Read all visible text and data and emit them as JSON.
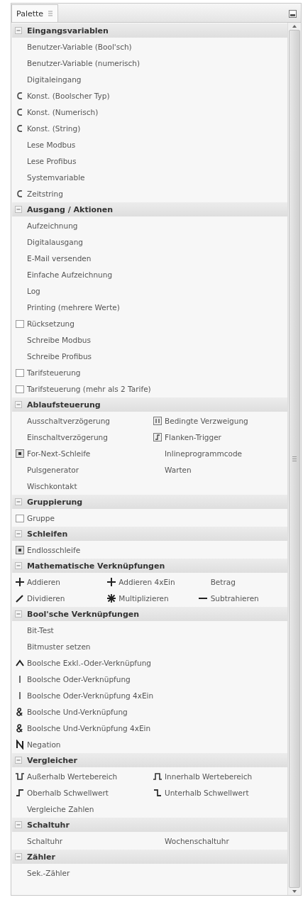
{
  "panel": {
    "tab": {
      "label": "Palette",
      "selected": true
    }
  },
  "sections": [
    {
      "title": "Eingangsvariablen",
      "expanded": true,
      "kind": "list",
      "items": [
        {
          "label": "Benutzer-Variable (Bool'sch)",
          "kind": "plain"
        },
        {
          "label": "Benutzer-Variable (numerisch)",
          "kind": "plain"
        },
        {
          "label": "Digitaleingang",
          "kind": "plain"
        },
        {
          "label": "Konst. (Boolscher Typ)",
          "kind": "constant"
        },
        {
          "label": "Konst. (Numerisch)",
          "kind": "constant"
        },
        {
          "label": "Konst. (String)",
          "kind": "constant"
        },
        {
          "label": "Lese Modbus",
          "kind": "plain"
        },
        {
          "label": "Lese Profibus",
          "kind": "plain"
        },
        {
          "label": "Systemvariable",
          "kind": "plain"
        },
        {
          "label": "Zeitstring",
          "kind": "constant"
        }
      ]
    },
    {
      "title": "Ausgang / Aktionen",
      "expanded": true,
      "kind": "list",
      "items": [
        {
          "label": "Aufzeichnung",
          "kind": "plain"
        },
        {
          "label": "Digitalausgang",
          "kind": "plain"
        },
        {
          "label": "E-Mail versenden",
          "kind": "plain"
        },
        {
          "label": "Einfache Aufzeichnung",
          "kind": "plain"
        },
        {
          "label": "Log",
          "kind": "plain"
        },
        {
          "label": "Printing (mehrere Werte)",
          "kind": "plain"
        },
        {
          "label": "Rücksetzung",
          "kind": "container"
        },
        {
          "label": "Schreibe Modbus",
          "kind": "plain"
        },
        {
          "label": "Schreibe Profibus",
          "kind": "plain"
        },
        {
          "label": "Tarifsteuerung",
          "kind": "container"
        },
        {
          "label": "Tarifsteuerung (mehr als 2 Tarife)",
          "kind": "container"
        }
      ]
    },
    {
      "title": "Ablaufsteuerung",
      "expanded": true,
      "kind": "double",
      "items": [
        {
          "label": "Ausschaltverzögerung",
          "kind": "plain"
        },
        {
          "label": "Bedingte Verzweigung",
          "kind": "branch"
        },
        {
          "label": "Einschaltverzögerung",
          "kind": "plain"
        },
        {
          "label": "Flanken-Trigger",
          "kind": "edge"
        },
        {
          "label": "For-Next-Schleife",
          "kind": "loop"
        },
        {
          "label": "Inlineprogrammcode",
          "kind": "plain"
        },
        {
          "label": "Pulsgenerator",
          "kind": "plain"
        },
        {
          "label": "Warten",
          "kind": "plain"
        },
        {
          "label": "Wischkontakt",
          "kind": "plain"
        }
      ]
    },
    {
      "title": "Gruppierung",
      "expanded": true,
      "kind": "list",
      "items": [
        {
          "label": "Gruppe",
          "kind": "container"
        }
      ]
    },
    {
      "title": "Schleifen",
      "expanded": true,
      "kind": "list",
      "items": [
        {
          "label": "Endlosschleife",
          "kind": "loop"
        }
      ]
    },
    {
      "title": "Mathematische Verknüpfungen",
      "expanded": true,
      "kind": "triple",
      "items": [
        {
          "label": "Addieren",
          "kind": "add"
        },
        {
          "label": "Addieren 4xEin",
          "kind": "add"
        },
        {
          "label": "Betrag",
          "kind": "plain"
        },
        {
          "label": "Dividieren",
          "kind": "divide"
        },
        {
          "label": "Multiplizieren",
          "kind": "multiply"
        },
        {
          "label": "Subtrahieren",
          "kind": "subtract"
        }
      ]
    },
    {
      "title": "Bool'sche Verknüpfungen",
      "expanded": true,
      "kind": "list",
      "items": [
        {
          "label": "Bit-Test",
          "kind": "plain"
        },
        {
          "label": "Bitmuster setzen",
          "kind": "plain"
        },
        {
          "label": "Boolsche Exkl.-Oder-Verknüpfung",
          "kind": "xor"
        },
        {
          "label": "Boolsche Oder-Verknüpfung",
          "kind": "or"
        },
        {
          "label": "Boolsche Oder-Verknüpfung 4xEin",
          "kind": "or"
        },
        {
          "label": "Boolsche Und-Verknüpfung",
          "kind": "and"
        },
        {
          "label": "Boolsche Und-Verknüpfung 4xEin",
          "kind": "and"
        },
        {
          "label": "Negation",
          "kind": "not"
        }
      ]
    },
    {
      "title": "Vergleicher",
      "expanded": true,
      "kind": "double",
      "items": [
        {
          "label": "Außerhalb Wertebereich",
          "kind": "outside"
        },
        {
          "label": "Innerhalb Wertebereich",
          "kind": "inside"
        },
        {
          "label": "Oberhalb Schwellwert",
          "kind": "above"
        },
        {
          "label": "Unterhalb Schwellwert",
          "kind": "below"
        },
        {
          "label": "Vergleiche Zahlen",
          "kind": "plain"
        }
      ]
    },
    {
      "title": "Schaltuhr",
      "expanded": true,
      "kind": "double",
      "items": [
        {
          "label": "Schaltuhr",
          "kind": "plain"
        },
        {
          "label": "Wochenschaltuhr",
          "kind": "plain"
        }
      ]
    },
    {
      "title": "Zähler",
      "expanded": true,
      "kind": "list",
      "items": [
        {
          "label": "Sek.-Zähler",
          "kind": "plain"
        }
      ]
    }
  ]
}
